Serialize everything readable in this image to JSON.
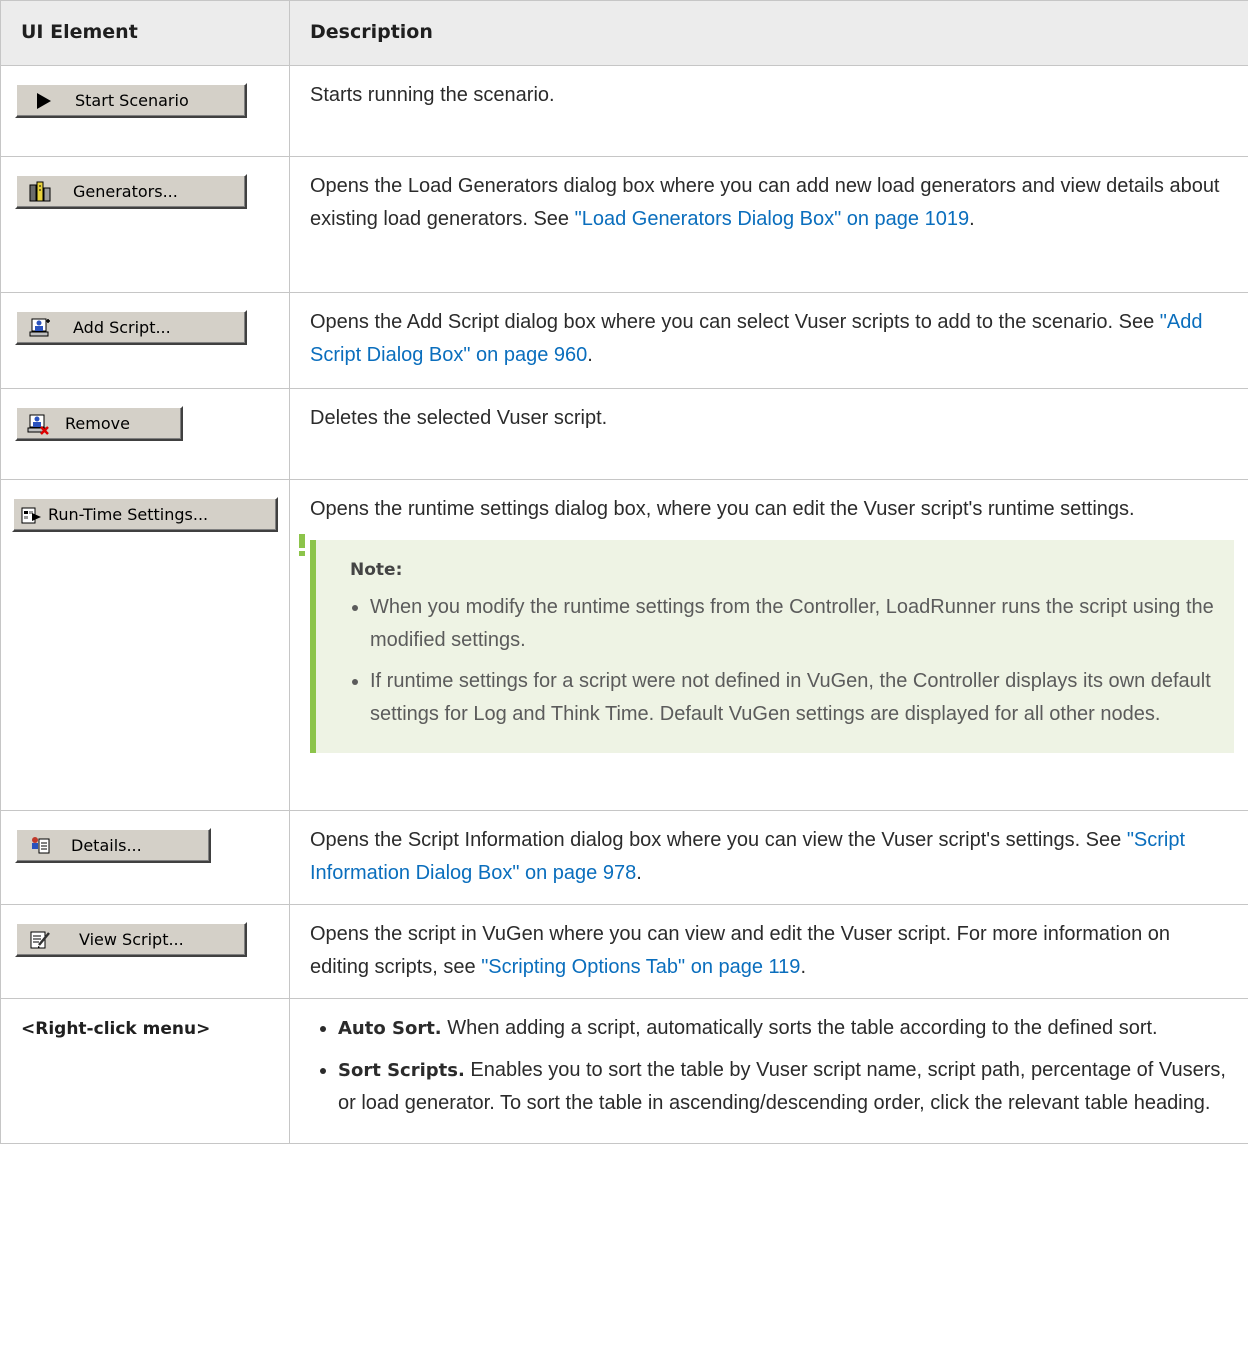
{
  "table": {
    "headers": [
      "UI Element",
      "Description"
    ],
    "rows": [
      {
        "button": {
          "label": "Start Scenario",
          "icon": "play-triangle-icon"
        },
        "desc": "Starts running the scenario."
      },
      {
        "button": {
          "label": "Generators...",
          "icon": "load-generators-icon"
        },
        "desc_pre": "Opens the Load Generators dialog box where you can add new load generators and view details about existing load generators. See ",
        "link": "\"Load Generators Dialog Box\" on page 1019",
        "desc_post": "."
      },
      {
        "button": {
          "label": "Add Script...",
          "icon": "add-script-icon"
        },
        "desc_pre": "Opens the Add Script dialog box where you can select Vuser scripts to add to the scenario. See ",
        "link": "\"Add Script Dialog Box\" on page 960",
        "desc_post": "."
      },
      {
        "button": {
          "label": "Remove",
          "icon": "remove-script-icon"
        },
        "desc": "Deletes the selected Vuser script."
      },
      {
        "button": {
          "label": "Run-Time Settings...",
          "icon": "run-time-settings-icon"
        },
        "desc": "Opens the runtime settings dialog box, where you can edit the Vuser script's runtime settings.",
        "note": {
          "title": "Note:",
          "items": [
            "When you modify the runtime settings from the Controller, LoadRunner runs the script using the modified settings.",
            "If runtime settings for a script were not defined in VuGen, the Controller displays its own default settings for Log and Think Time. Default VuGen settings are displayed for all other nodes."
          ]
        }
      },
      {
        "button": {
          "label": "Details...",
          "icon": "details-icon"
        },
        "desc_pre": "Opens the Script Information dialog box where you can view the Vuser script's settings. See ",
        "link": "\"Script Information Dialog Box\" on page 978",
        "desc_post": "."
      },
      {
        "button": {
          "label": "View Script...",
          "icon": "view-script-icon"
        },
        "desc_pre": "Opens the script in VuGen where you can view and edit the Vuser script. For more information on editing scripts, see ",
        "link": "\"Scripting Options Tab\" on page 119",
        "desc_post": "."
      },
      {
        "label": "<Right-click menu>",
        "items": [
          {
            "bold": "Auto Sort.",
            "text": " When adding a script, automatically sorts the table according to the defined sort."
          },
          {
            "bold": "Sort Scripts.",
            "text": " Enables you to sort the table by Vuser script name, script path, percentage of Vusers, or load generator. To sort the table in ascending/descending order, click the relevant table heading."
          }
        ]
      }
    ]
  },
  "colors": {
    "link": "#0a6ebd",
    "header_bg": "#ececec",
    "note_bg": "#eef3e4",
    "note_bar": "#8cc44a"
  }
}
